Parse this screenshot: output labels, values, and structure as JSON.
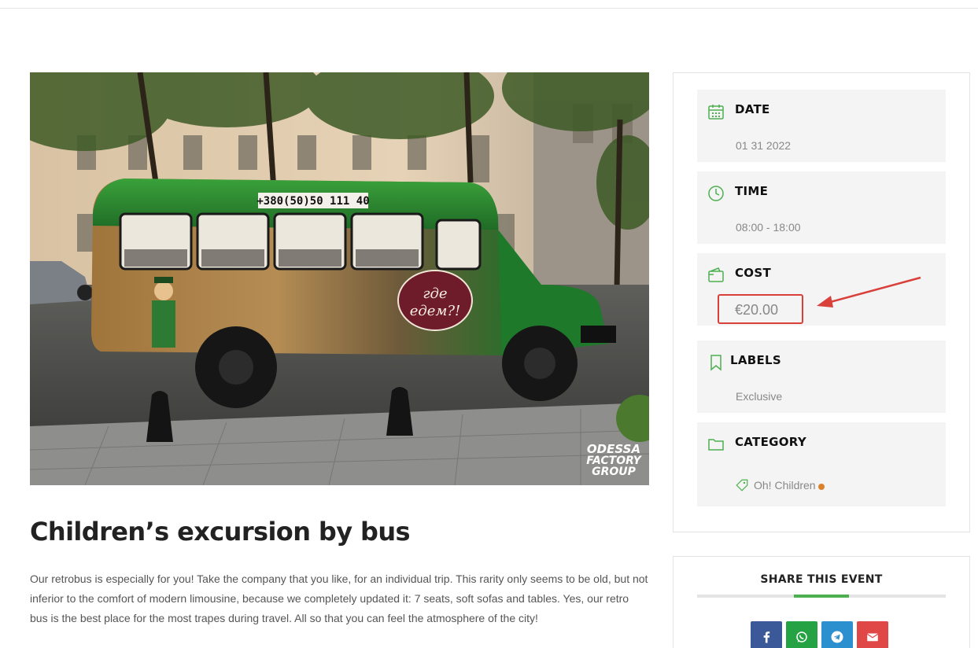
{
  "event": {
    "title": "Children’s excursion by bus",
    "description": "Our retrobus is especially for you! Take the company that you like, for an individual trip. This rarity only seems to be old, but not inferior to the comfort of modern limousine, because we completely updated it: 7 seats, soft sofas and tables. Yes, our retro bus is the best place for the most trapes during travel. All so that you can feel the atmosphere of the city!"
  },
  "photo": {
    "bus_phone": "+380(50)50  111  40",
    "bus_bubble_line1": "где",
    "bus_bubble_line2": "едем?!",
    "watermark_line1": "ODESSA",
    "watermark_line2": "FACTORY",
    "watermark_line3": "GROUP"
  },
  "info": {
    "date_label": "DATE",
    "date_value": "01 31 2022",
    "time_label": "TIME",
    "time_value": "08:00 - 18:00",
    "cost_label": "COST",
    "cost_value": "€20.00",
    "labels_label": "LABELS",
    "labels_value": "Exclusive",
    "category_label": "CATEGORY",
    "category_value": "Oh! Children"
  },
  "share": {
    "title": "SHARE THIS EVENT",
    "buttons": [
      "facebook-icon",
      "whatsapp-icon",
      "telegram-icon",
      "email-icon"
    ]
  },
  "colors": {
    "accent_green": "#4caf50",
    "highlight_red": "#d9403a",
    "facebook": "#3b5998",
    "whatsapp": "#25a244",
    "telegram": "#2c8fce",
    "email": "#e04848",
    "category_dot": "#d9822b"
  }
}
